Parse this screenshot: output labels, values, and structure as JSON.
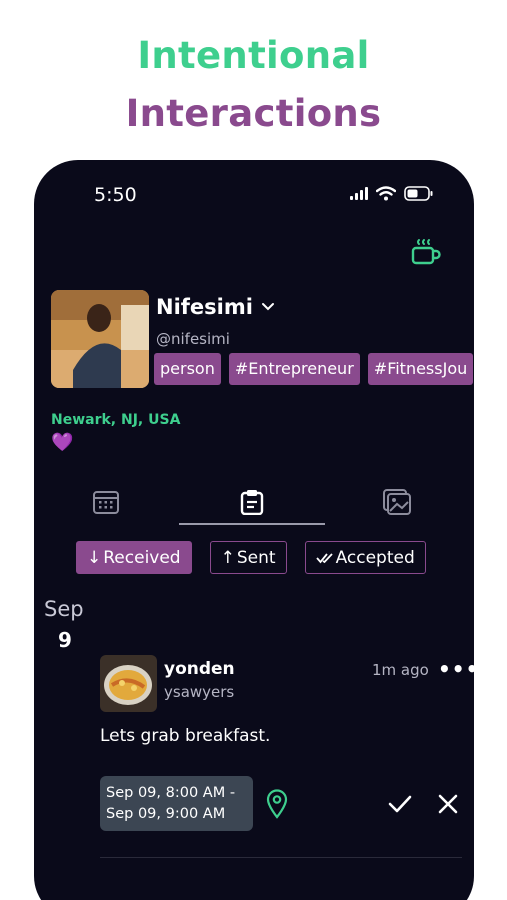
{
  "headline": {
    "line1": "Intentional",
    "line2": "Interactions"
  },
  "status_bar": {
    "time": "5:50"
  },
  "profile": {
    "name": "Nifesimi",
    "handle": "@nifesimi",
    "tags": [
      "person",
      "#Entrepreneur",
      "#FitnessJou"
    ],
    "location": "Newark, NJ, USA",
    "emoji": "💜"
  },
  "filters": {
    "received": "Received",
    "sent": "Sent",
    "accepted": "Accepted"
  },
  "feed": {
    "date_month": "Sep",
    "date_day": "9",
    "item": {
      "username": "yonden",
      "subname": "ysawyers",
      "time_ago": "1m ago",
      "more": "•••",
      "message": "Lets grab breakfast.",
      "time_line1": "Sep 09, 8:00 AM -",
      "time_line2": "Sep 09, 9:00 AM"
    }
  },
  "colors": {
    "accent_green": "#3ecf8e",
    "accent_purple": "#8a4a8e",
    "background": "#0a0a1a"
  }
}
